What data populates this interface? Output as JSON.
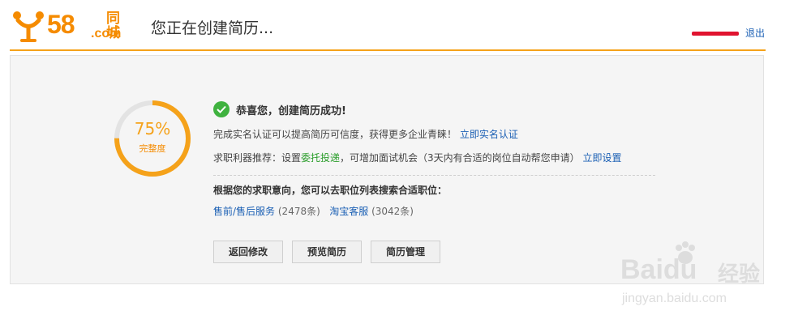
{
  "header": {
    "brand_number": "58",
    "brand_cn": "同城",
    "brand_domain": ".com",
    "page_title": "您正在创建简历...",
    "logout_label": "退出"
  },
  "progress": {
    "percent_text": "75%",
    "percent_value": 75,
    "label": "完整度",
    "color": "#f5a21a"
  },
  "success": {
    "title": "恭喜您，创建简历成功!"
  },
  "verify": {
    "text": "完成实名认证可以提高简历可信度，获得更多企业青睐！",
    "link": "立即实名认证"
  },
  "recommend": {
    "prefix": "求职利器推荐：设置",
    "highlight": "委托投递",
    "suffix": "，可增加面试机会（3天内有合适的岗位自动帮您申请）",
    "link": "立即设置"
  },
  "search": {
    "prompt": "根据您的求职意向，您可以去职位列表搜索合适职位：",
    "jobs": [
      {
        "name": "售前/售后服务",
        "count": "(2478条)"
      },
      {
        "name": "淘宝客服",
        "count": "(3042条)"
      }
    ]
  },
  "buttons": {
    "back_edit": "返回修改",
    "preview": "预览简历",
    "manage": "简历管理"
  },
  "watermark": {
    "brand": "Baidu",
    "cn": "经验",
    "url": "jingyan.baidu.com"
  },
  "colors": {
    "accent": "#f58b00",
    "link": "#1a5fb4",
    "success": "#3fb23f"
  }
}
